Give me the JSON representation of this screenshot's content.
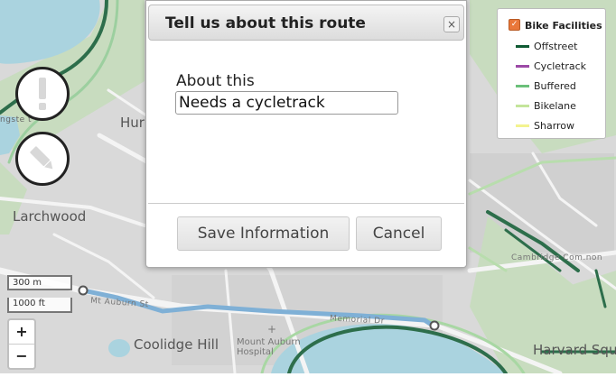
{
  "map": {
    "labels": {
      "larchwood": "Larchwood",
      "coolidge_hill": "Coolidge Hill",
      "harvard_sq": "Harvard Squ",
      "hur": "Hur",
      "mount_auburn_hospital": "Mount Auburn\nHospital",
      "cambridge_common": "Cambridge Com.non",
      "mount_auburn_st": "Mt Auburn St",
      "memorial_dr": "Memorial Dr",
      "ngstert": "ngste  t"
    },
    "scale": {
      "metric": "300 m",
      "imperial": "1000 ft"
    },
    "zoom": {
      "in": "+",
      "out": "−"
    },
    "colors": {
      "water": "#aad3df",
      "route": "#7fb0d6",
      "offstreet": "#2d6e4b"
    }
  },
  "actions": {
    "report_icon": "exclamation-icon",
    "edit_icon": "pencil-icon"
  },
  "legend": {
    "title": "Bike Facilities",
    "items": [
      {
        "label": "Offstreet",
        "color": "#0f5a33"
      },
      {
        "label": "Cycletrack",
        "color": "#9c4aa6"
      },
      {
        "label": "Buffered",
        "color": "#6bc07a"
      },
      {
        "label": "Bikelane",
        "color": "#c4e59b"
      },
      {
        "label": "Sharrow",
        "color": "#f3f38f"
      }
    ]
  },
  "dialog": {
    "title": "Tell us about this route",
    "close": "×",
    "field_label": "About this",
    "field_value": "Needs a cycletrack",
    "save_label": "Save Information",
    "cancel_label": "Cancel"
  }
}
